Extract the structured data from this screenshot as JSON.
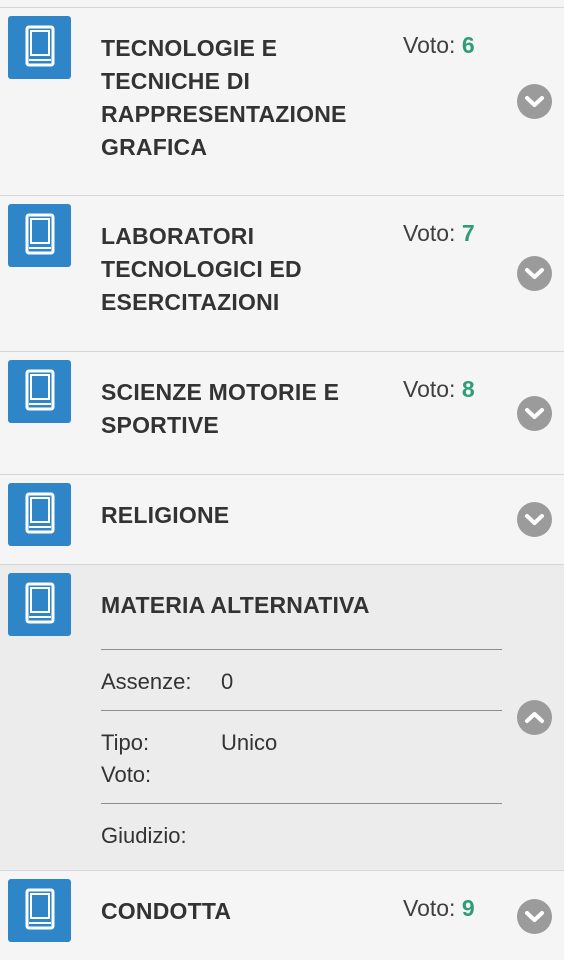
{
  "icons": {
    "subject": "book-icon",
    "collapsed": "chevron-down-icon",
    "expanded": "chevron-up-icon"
  },
  "colors": {
    "icon_bg": "#2e86c8",
    "grade_number": "#2f9c7a",
    "chevron_bg": "#9b9b9b"
  },
  "grade_label": "Voto:",
  "subjects": [
    {
      "name": "TECNOLOGIE E TECNICHE DI RAPPRESENTAZIONE GRAFICA",
      "grade": "6"
    },
    {
      "name": "LABORATORI TECNOLOGICI ED ESERCITAZIONI",
      "grade": "7"
    },
    {
      "name": "SCIENZE MOTORIE E SPORTIVE",
      "grade": "8"
    },
    {
      "name": "RELIGIONE",
      "grade": ""
    },
    {
      "name": "MATERIA ALTERNATIVA",
      "grade": ""
    },
    {
      "name": "CONDOTTA",
      "grade": "9"
    }
  ],
  "details": {
    "absences_label": "Assenze:",
    "absences_value": "0",
    "type_label": "Tipo:",
    "type_label_2": "Voto:",
    "type_value": "Unico",
    "judgment_label": "Giudizio:"
  }
}
